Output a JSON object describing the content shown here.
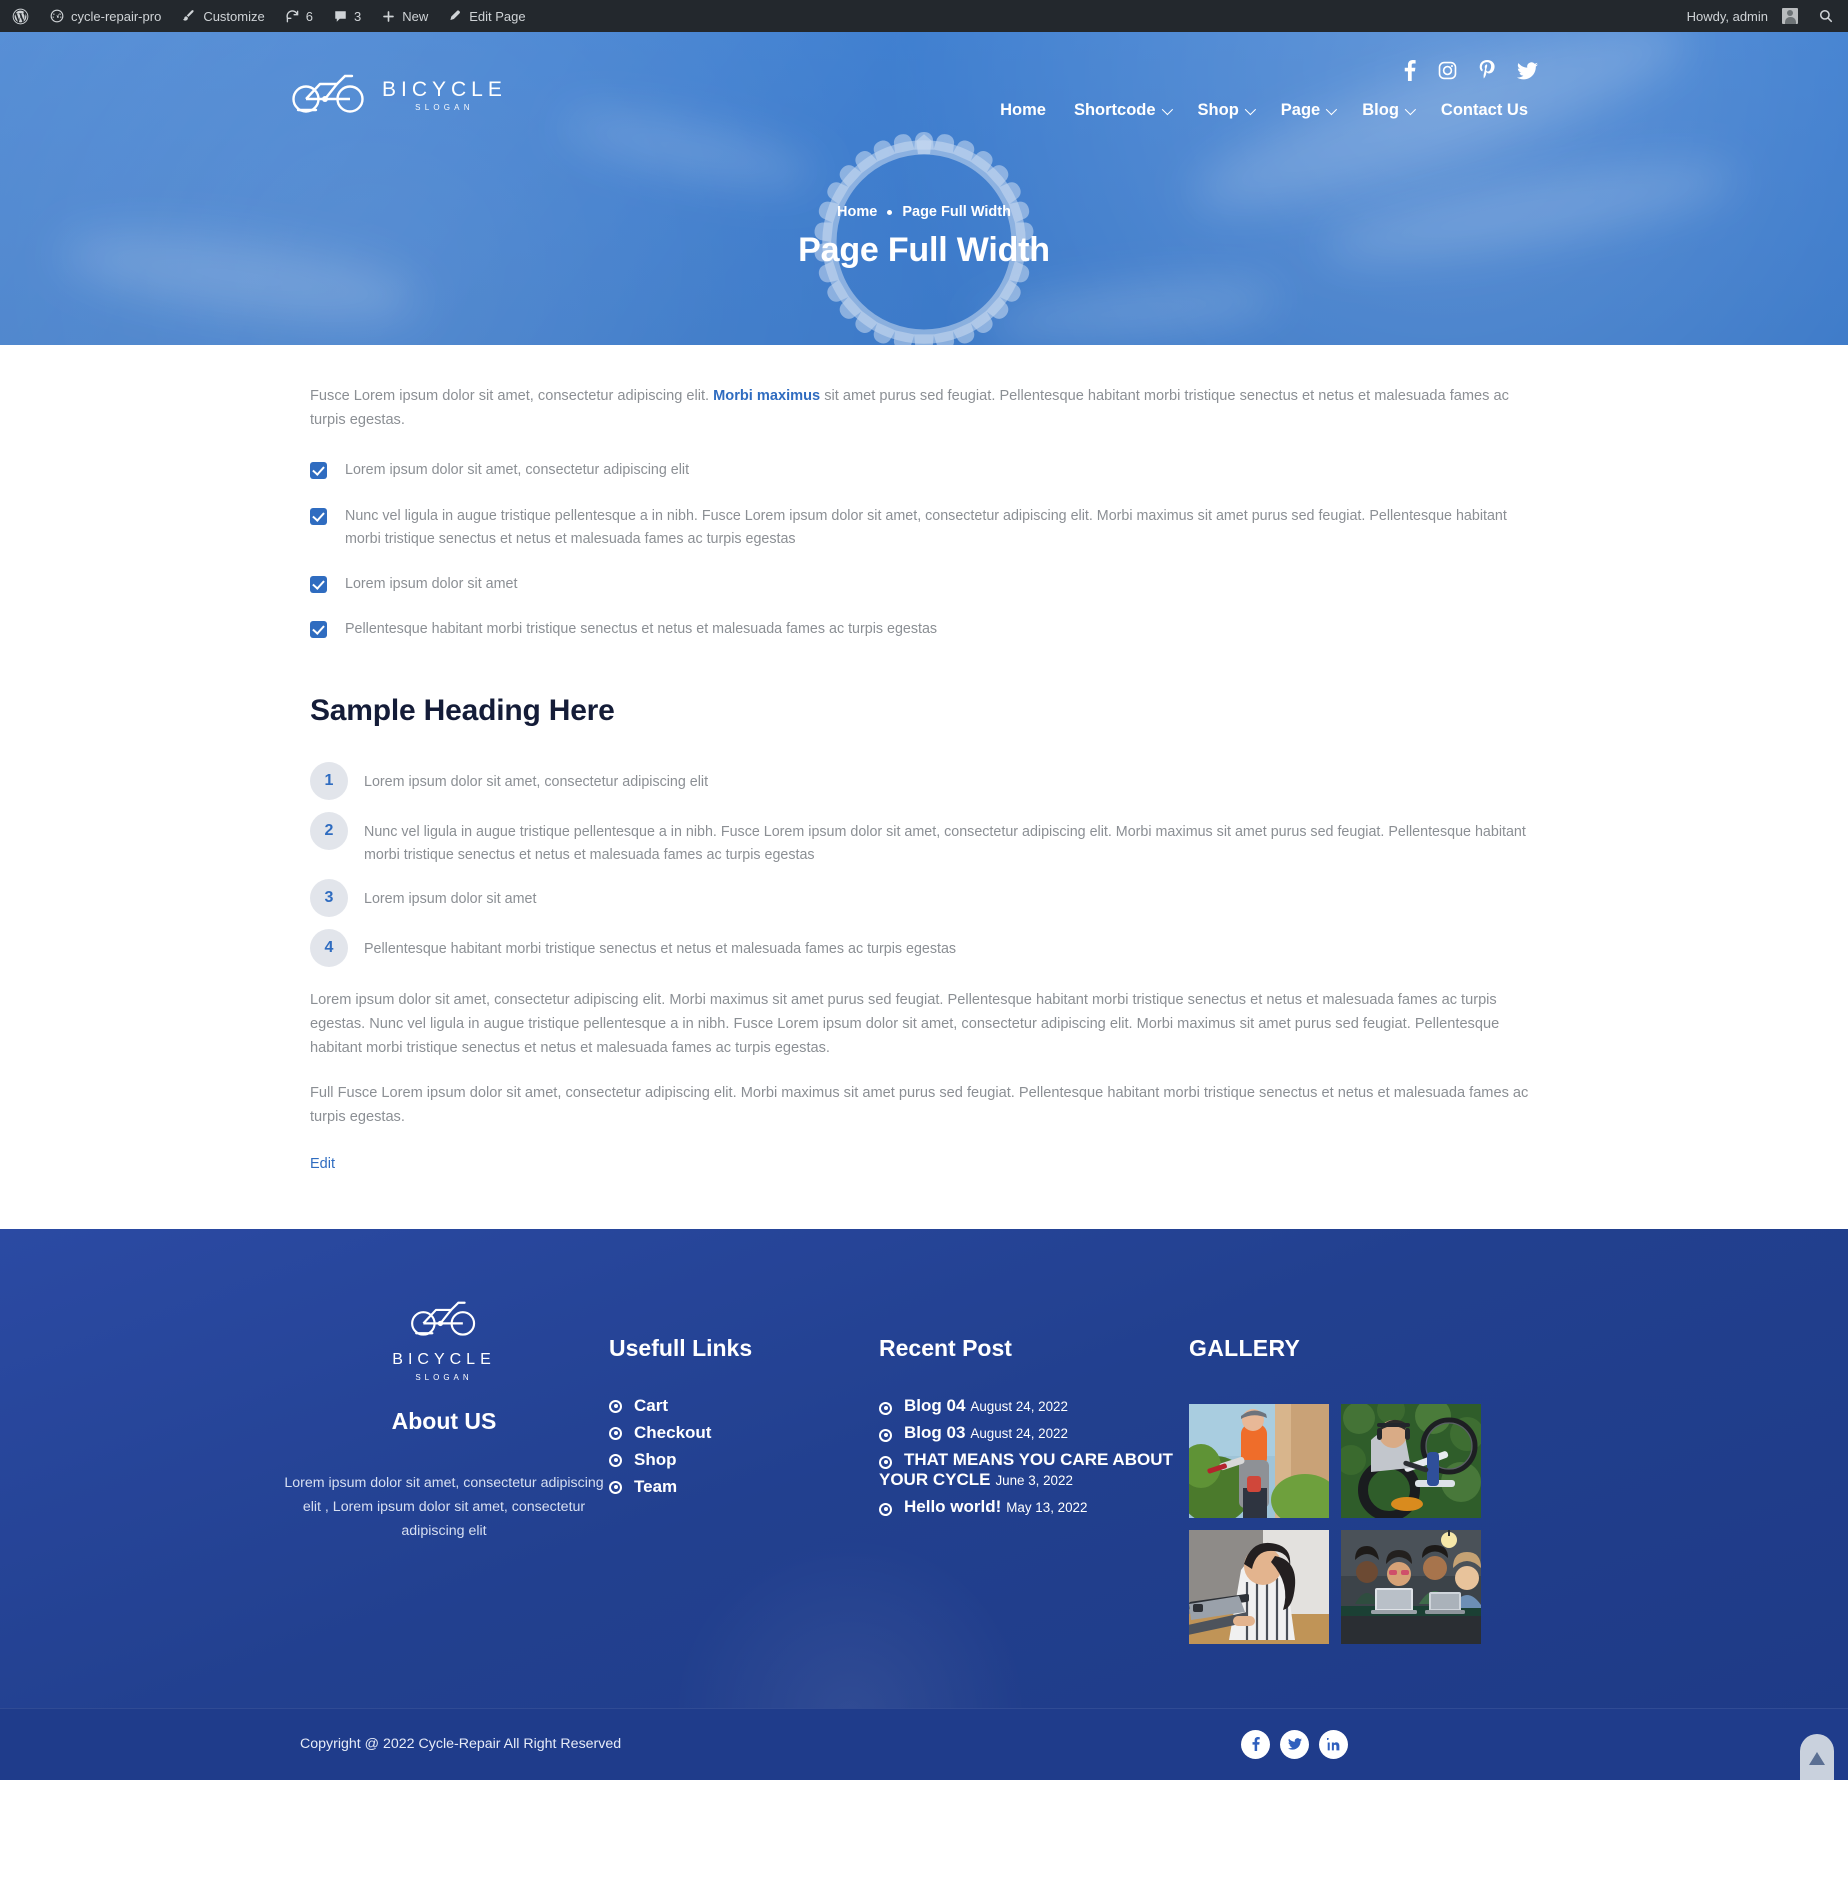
{
  "adminbar": {
    "wp_logo_icon": "wordpress-icon",
    "site_icon": "dashboard-icon",
    "site_name": "cycle-repair-pro",
    "customize_icon": "paintbrush-icon",
    "customize_label": "Customize",
    "updates_icon": "updates-icon",
    "updates_count": "6",
    "comments_icon": "comment-icon",
    "comments_count": "3",
    "new_icon": "plus-icon",
    "new_label": "New",
    "edit_icon": "pencil-icon",
    "edit_label": "Edit Page",
    "howdy": "Howdy, admin",
    "avatar_icon": "user-avatar",
    "search_icon": "search-icon"
  },
  "header": {
    "logo": {
      "title": "BICYCLE",
      "slogan": "SLOGAN",
      "icon": "bicycle-logo-icon"
    },
    "socials": [
      {
        "name": "facebook-icon",
        "label": "Facebook"
      },
      {
        "name": "instagram-icon",
        "label": "Instagram"
      },
      {
        "name": "pinterest-icon",
        "label": "Pinterest"
      },
      {
        "name": "twitter-icon",
        "label": "Twitter"
      }
    ],
    "nav": [
      {
        "label": "Home",
        "has_submenu": false
      },
      {
        "label": "Shortcode",
        "has_submenu": true
      },
      {
        "label": "Shop",
        "has_submenu": true
      },
      {
        "label": "Page",
        "has_submenu": true
      },
      {
        "label": "Blog",
        "has_submenu": true
      },
      {
        "label": "Contact Us",
        "has_submenu": false
      }
    ]
  },
  "hero": {
    "breadcrumb_home": "Home",
    "breadcrumb_current": "Page Full Width",
    "title": "Page Full Width",
    "bg_color": "#3d7ccd"
  },
  "content": {
    "intro_before": "Fusce Lorem ipsum dolor sit amet, consectetur adipiscing elit. ",
    "intro_bold": "Morbi maximus",
    "intro_after": " sit amet purus sed feugiat. Pellentesque habitant morbi tristique senectus et netus et malesuada fames ac turpis egestas.",
    "checklist": [
      "Lorem ipsum dolor sit amet, consectetur adipiscing elit",
      "Nunc vel ligula in augue tristique pellentesque a in nibh. Fusce Lorem ipsum dolor sit amet, consectetur adipiscing elit. Morbi maximus sit amet purus sed feugiat. Pellentesque habitant morbi tristique senectus et netus et malesuada fames ac turpis egestas",
      "Lorem ipsum dolor sit amet",
      "Pellentesque habitant morbi tristique senectus et netus et malesuada fames ac turpis egestas"
    ],
    "sample_heading": "Sample Heading Here",
    "numbered": [
      {
        "n": "1",
        "text": "Lorem ipsum dolor sit amet, consectetur adipiscing elit"
      },
      {
        "n": "2",
        "text": "Nunc vel ligula in augue tristique pellentesque a in nibh. Fusce Lorem ipsum dolor sit amet, consectetur adipiscing elit. Morbi maximus sit amet purus sed feugiat. Pellentesque habitant morbi tristique senectus et netus et malesuada fames ac turpis egestas"
      },
      {
        "n": "3",
        "text": "Lorem ipsum dolor sit amet"
      },
      {
        "n": "4",
        "text": "Pellentesque habitant morbi tristique senectus et netus et malesuada fames ac turpis egestas"
      }
    ],
    "para1": "Lorem ipsum dolor sit amet, consectetur adipiscing elit. Morbi maximus sit amet purus sed feugiat. Pellentesque habitant morbi tristique senectus et netus et malesuada fames ac turpis egestas. Nunc vel ligula in augue tristique pellentesque a in nibh. Fusce Lorem ipsum dolor sit amet, consectetur adipiscing elit. Morbi maximus sit amet purus sed feugiat. Pellentesque habitant morbi tristique senectus et netus et malesuada fames ac turpis egestas.",
    "para2": "Full Fusce Lorem ipsum dolor sit amet, consectetur adipiscing elit. Morbi maximus sit amet purus sed feugiat. Pellentesque habitant morbi tristique senectus et netus et malesuada fames ac turpis egestas.",
    "edit_label": "Edit"
  },
  "footer": {
    "logo": {
      "title": "BICYCLE",
      "slogan": "SLOGAN",
      "icon": "bicycle-logo-icon"
    },
    "about_heading": "About US",
    "about_text": "Lorem ipsum dolor sit amet, consectetur adipiscing elit , Lorem ipsum dolor sit amet, consectetur adipiscing elit",
    "links_heading": "Usefull Links",
    "links": [
      "Cart",
      "Checkout",
      "Shop",
      "Team"
    ],
    "recent_heading": "Recent Post",
    "recent": [
      {
        "title": "Blog 04",
        "date": "August 24, 2022"
      },
      {
        "title": "Blog 03",
        "date": "August 24, 2022"
      },
      {
        "title": "THAT MEANS YOU CARE ABOUT YOUR CYCLE",
        "date": "June 3, 2022"
      },
      {
        "title": "Hello world!",
        "date": "May 13, 2022"
      }
    ],
    "gallery_heading": "GALLERY",
    "gallery": [
      {
        "alt": "worker-trimming-hedge-photo"
      },
      {
        "alt": "man-repairing-bicycle-photo"
      },
      {
        "alt": "woman-using-laptop-photo"
      },
      {
        "alt": "team-meeting-photo"
      }
    ],
    "bg_color": "#22408f"
  },
  "copyright": {
    "text": "Copyright @ 2022 Cycle-Repair All Right Reserved",
    "socials": [
      {
        "name": "facebook-icon",
        "label": "Facebook"
      },
      {
        "name": "twitter-icon",
        "label": "Twitter"
      },
      {
        "name": "linkedin-icon",
        "label": "LinkedIn"
      }
    ],
    "back_to_top_icon": "arrow-up-icon"
  }
}
